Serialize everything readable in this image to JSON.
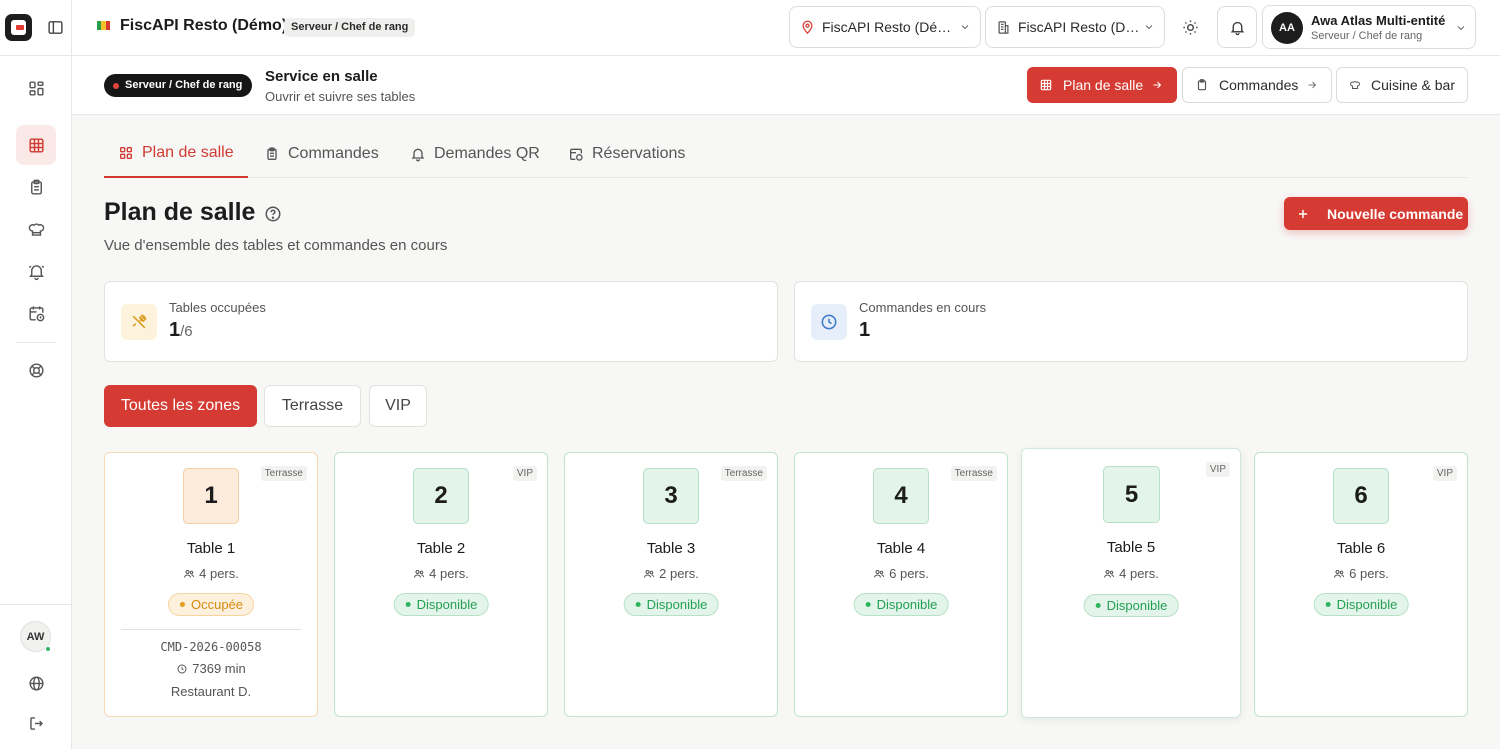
{
  "header": {
    "app_title": "FiscAPI Resto (Démo)",
    "role_badge": "Serveur / Chef de rang",
    "location_select": "FiscAPI Resto (Dé…",
    "entity_select": "FiscAPI Resto (D…",
    "user": {
      "initials": "AA",
      "name": "Awa Atlas Multi-entité",
      "role": "Serveur / Chef de rang"
    }
  },
  "sidebar": {
    "items": [
      {
        "name": "dashboard",
        "icon": "grid-icon"
      },
      {
        "name": "floor-plan",
        "icon": "table-grid-icon",
        "active": true
      },
      {
        "name": "orders",
        "icon": "clipboard-icon"
      },
      {
        "name": "kitchen",
        "icon": "chef-hat-icon"
      },
      {
        "name": "qr-requests",
        "icon": "bell-ring-icon"
      },
      {
        "name": "reservations",
        "icon": "calendar-clock-icon"
      },
      {
        "name": "support",
        "icon": "lifebuoy-icon"
      }
    ],
    "avatar_initials": "AW"
  },
  "subheader": {
    "role_pill": "Serveur / Chef de rang",
    "title": "Service en salle",
    "desc": "Ouvrir et suivre ses tables",
    "quick_links": [
      "Plan de salle",
      "Commandes",
      "Cuisine & bar"
    ]
  },
  "tabs": [
    "Plan de salle",
    "Commandes",
    "Demandes QR",
    "Réservations"
  ],
  "page": {
    "title": "Plan de salle",
    "desc": "Vue d'ensemble des tables et commandes en cours",
    "new_order": "Nouvelle commande"
  },
  "stats": {
    "occupied": {
      "label": "Tables occupées",
      "value": "1",
      "total": "/6"
    },
    "orders": {
      "label": "Commandes en cours",
      "value": "1"
    }
  },
  "zones": [
    "Toutes les zones",
    "Terrasse",
    "VIP"
  ],
  "tables": [
    {
      "num": "1",
      "zone": "Terrasse",
      "name": "Table 1",
      "seats": "4 pers.",
      "status": "Occupée",
      "state": "busy",
      "order": {
        "code": "CMD-2026-00058",
        "duration": "7369 min",
        "place": "Restaurant D."
      }
    },
    {
      "num": "2",
      "zone": "VIP",
      "name": "Table 2",
      "seats": "4 pers.",
      "status": "Disponible",
      "state": "free"
    },
    {
      "num": "3",
      "zone": "Terrasse",
      "name": "Table 3",
      "seats": "2 pers.",
      "status": "Disponible",
      "state": "free"
    },
    {
      "num": "4",
      "zone": "Terrasse",
      "name": "Table 4",
      "seats": "6 pers.",
      "status": "Disponible",
      "state": "free"
    },
    {
      "num": "5",
      "zone": "VIP",
      "name": "Table 5",
      "seats": "4 pers.",
      "status": "Disponible",
      "state": "free"
    },
    {
      "num": "6",
      "zone": "VIP",
      "name": "Table 6",
      "seats": "6 pers.",
      "status": "Disponible",
      "state": "free"
    }
  ],
  "colors": {
    "brand": "#d53b32",
    "available": "#25a154",
    "occupied": "#d88b11"
  }
}
